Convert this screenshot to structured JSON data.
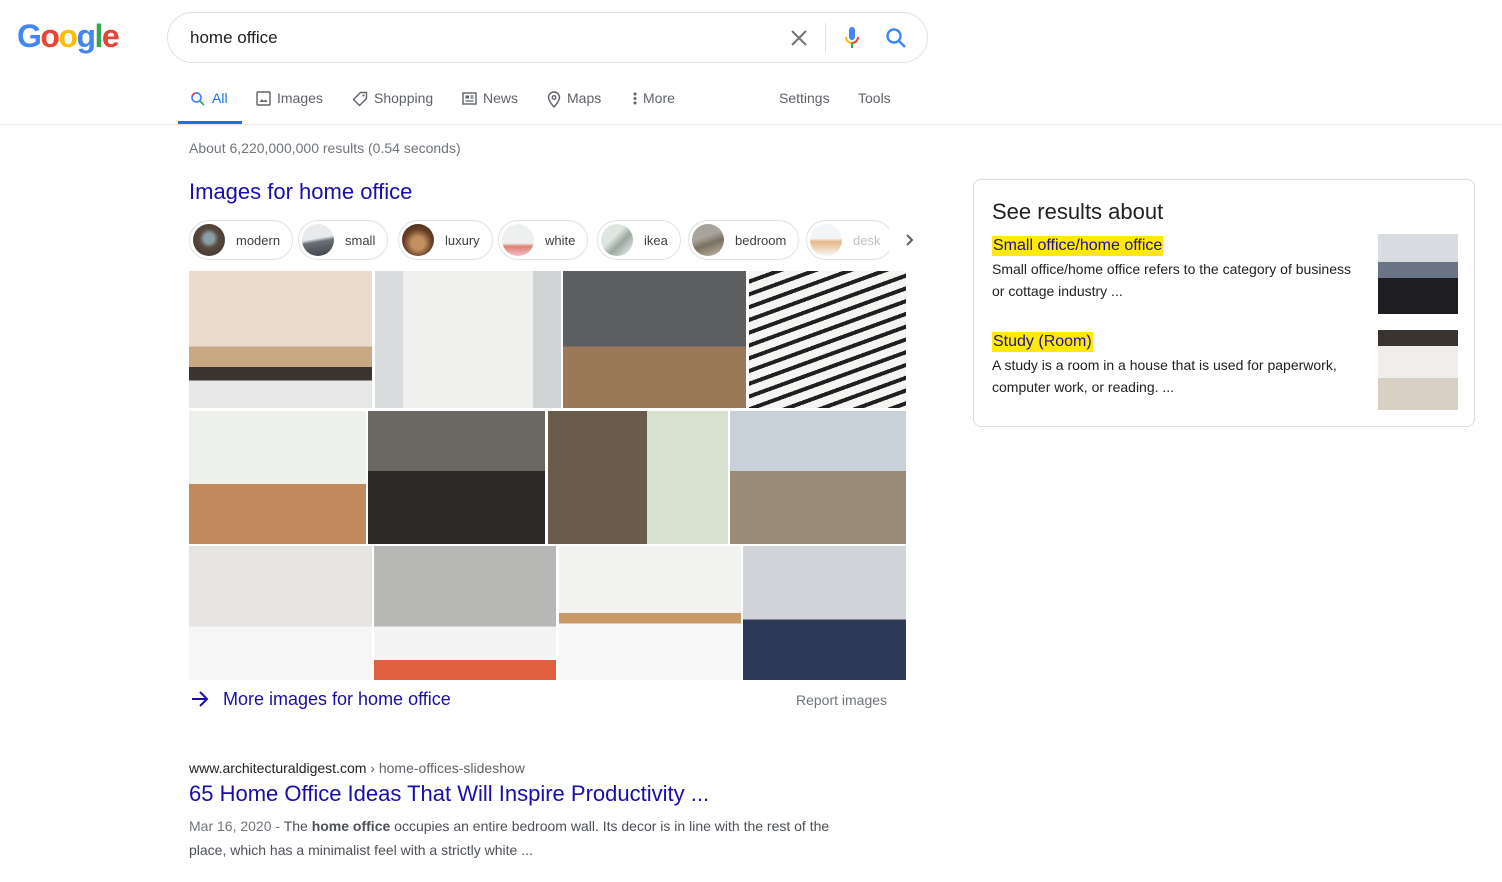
{
  "logo": {
    "letters": [
      "G",
      "o",
      "o",
      "g",
      "l",
      "e"
    ],
    "colors": [
      "#4285f4",
      "#ea4335",
      "#fbbc05",
      "#4285f4",
      "#34a853",
      "#ea4335"
    ]
  },
  "search": {
    "query": "home office",
    "clear_icon": "close-icon",
    "voice_icon": "microphone-icon",
    "search_icon": "search-icon"
  },
  "tabs": [
    {
      "label": "All",
      "icon": "search-icon",
      "active": true
    },
    {
      "label": "Images",
      "icon": "image-icon"
    },
    {
      "label": "Shopping",
      "icon": "tag-icon"
    },
    {
      "label": "News",
      "icon": "newspaper-icon"
    },
    {
      "label": "Maps",
      "icon": "map-pin-icon"
    },
    {
      "label": "More",
      "icon": "more-vert-icon"
    }
  ],
  "tools": {
    "settings": "Settings",
    "tools": "Tools"
  },
  "stats": "About 6,220,000,000 results (0.54 seconds)",
  "images_section": {
    "heading": "Images for home office",
    "chips": [
      "modern",
      "small",
      "luxury",
      "white",
      "ikea",
      "bedroom",
      "desk"
    ],
    "more_images": "More images for home office",
    "report": "Report images"
  },
  "result": {
    "domain": "www.architecturaldigest.com",
    "path": " › home-offices-slideshow",
    "title": "65 Home Office Ideas That Will Inspire Productivity ...",
    "date": "Mar 16, 2020 - ",
    "snippet_pre": "The ",
    "snippet_bold": "home office",
    "snippet_post": " occupies an entire bedroom wall. Its decor is in line with the rest of the place, which has a minimalist feel with a strictly white ..."
  },
  "panel": {
    "title": "See results about",
    "items": [
      {
        "title": "Small office/home office",
        "desc": "Small office/home office refers to the category of business or cottage industry ..."
      },
      {
        "title": "Study (Room)",
        "desc": "A study is a room in a house that is used for paperwork, computer work, or reading. ..."
      }
    ]
  },
  "colors": {
    "link": "#1a0dab",
    "accent": "#1a73e8",
    "highlight": "#ffea00"
  }
}
